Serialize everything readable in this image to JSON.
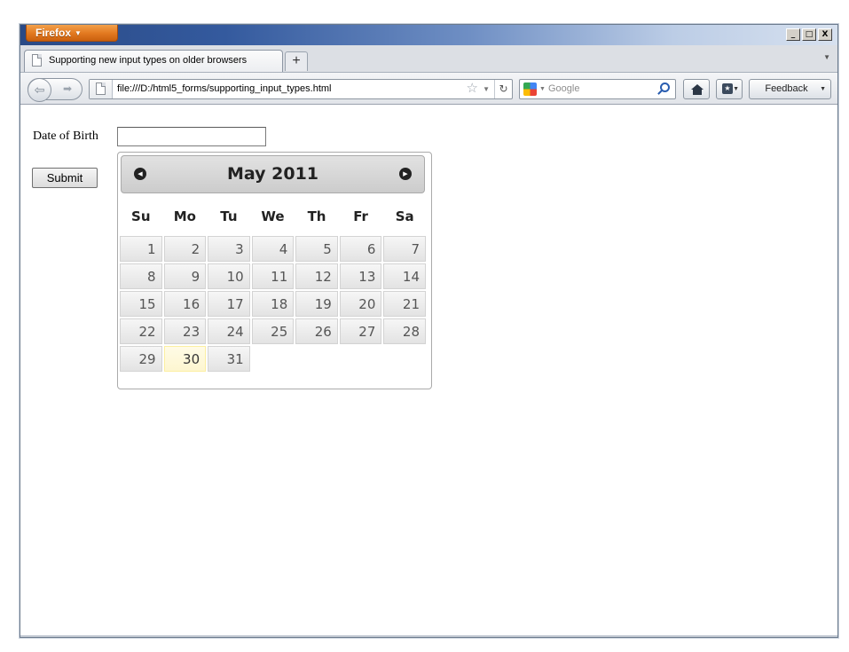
{
  "browser": {
    "menu_button_label": "Firefox",
    "window_controls": {
      "minimize": "_",
      "maximize": "□",
      "close": "X"
    },
    "tab_title": "Supporting new input types on older browsers",
    "new_tab_label": "+",
    "url": "file:///D:/html5_forms/supporting_input_types.html",
    "search_placeholder": "Google",
    "feedback_label": "Feedback",
    "icons": [
      "page-icon",
      "back-icon",
      "forward-icon",
      "star-icon",
      "reload-icon",
      "google-icon",
      "search-icon",
      "home-icon",
      "bookmarks-icon"
    ]
  },
  "form": {
    "dob_label": "Date of Birth",
    "dob_value": "",
    "submit_label": "Submit"
  },
  "datepicker": {
    "title": "May 2011",
    "prev_label": "◀",
    "next_label": "▶",
    "weekdays": [
      "Su",
      "Mo",
      "Tu",
      "We",
      "Th",
      "Fr",
      "Sa"
    ],
    "weeks": [
      [
        "1",
        "2",
        "3",
        "4",
        "5",
        "6",
        "7"
      ],
      [
        "8",
        "9",
        "10",
        "11",
        "12",
        "13",
        "14"
      ],
      [
        "15",
        "16",
        "17",
        "18",
        "19",
        "20",
        "21"
      ],
      [
        "22",
        "23",
        "24",
        "25",
        "26",
        "27",
        "28"
      ],
      [
        "29",
        "30",
        "31",
        "",
        "",
        "",
        ""
      ]
    ],
    "today": "30"
  }
}
